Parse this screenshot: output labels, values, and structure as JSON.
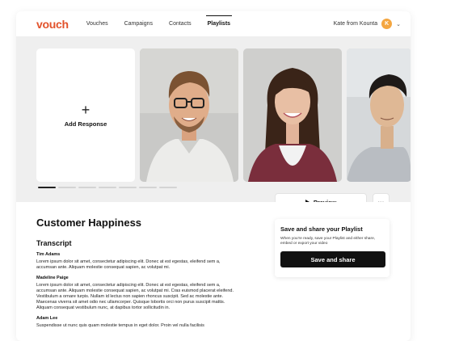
{
  "brand": {
    "logo": "vouch",
    "color": "#e2522b"
  },
  "nav": {
    "items": [
      {
        "label": "Vouches",
        "active": false
      },
      {
        "label": "Campaigns",
        "active": false
      },
      {
        "label": "Contacts",
        "active": false
      },
      {
        "label": "Playlists",
        "active": true
      }
    ]
  },
  "user": {
    "name": "Kate from Kounta",
    "avatar_initial": "K",
    "avatar_color": "#f4a640",
    "chevron": "chevron-down-icon"
  },
  "strip": {
    "add_label": "Add Response",
    "plus_icon": "plus-icon"
  },
  "actions": {
    "preview_label": "Preview",
    "more_label": "···"
  },
  "share": {
    "title": "Save and share your Playlist",
    "description": "When you're ready, save your Playlist and either share, embed or export your video",
    "button_label": "Save and share"
  },
  "page": {
    "title": "Customer Happiness"
  },
  "transcript": {
    "heading": "Transcript",
    "entries": [
      {
        "speaker": "Tim Adams",
        "text": "Lorem ipsum dolor sit amet, consectetur adipiscing elit. Donec at est egestas, eleifend sem a, accumsan ante. Aliquam molestie consequat sapien, ac volutpat mi."
      },
      {
        "speaker": "Madeline Paige",
        "text": "Lorem ipsum dolor sit amet, consectetur adipiscing elit. Donec at est egestas, eleifend sem a, accumsan ante. Aliquam molestie consequat sapien, ac volutpat mi. Cras euismod placerat eleifend. Vestibulum a ornare turpis. Nullam id lectus non sapien rhoncus suscipit. Sed ac molestie ante. Maecenas viverra sit amet odio nec ullamcorper. Quisque lobortis orci non purus suscipit mattis. Aliquam consequat vestibulum nunc, at dapibus tortor sollicitudin in."
      },
      {
        "speaker": "Adam Lee",
        "text": "Suspendisse ut nunc quis quam molestie tempus in eget dolor. Proin vel nulla facilisis"
      }
    ]
  }
}
